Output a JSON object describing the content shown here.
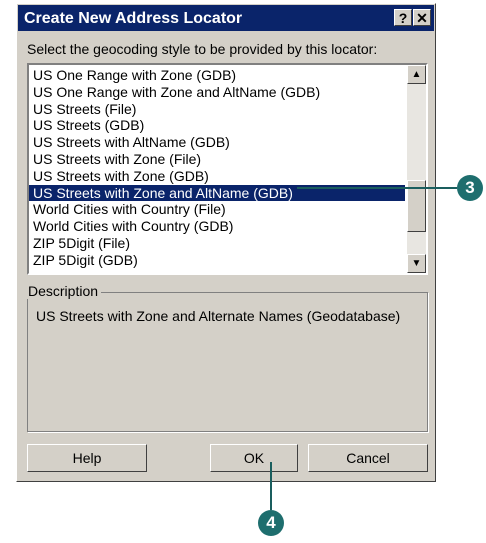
{
  "dialog": {
    "title": "Create New Address Locator",
    "help_glyph": "?",
    "close_glyph": "✕",
    "prompt": "Select the geocoding style to be provided by this locator:",
    "list_items": [
      "US One Range with Zone (GDB)",
      "US One Range with Zone and AltName (GDB)",
      "US Streets (File)",
      "US Streets (GDB)",
      "US Streets with AltName (GDB)",
      "US Streets with Zone (File)",
      "US Streets with Zone (GDB)",
      "US Streets with Zone and AltName (GDB)",
      "World Cities with Country (File)",
      "World Cities with Country (GDB)",
      "ZIP 5Digit (File)",
      "ZIP 5Digit (GDB)"
    ],
    "selected_index": 7,
    "scroll_up_glyph": "▲",
    "scroll_down_glyph": "▼",
    "description_label": "Description",
    "description_text": "US Streets with Zone and Alternate Names (Geodatabase)",
    "help_button": "Help",
    "ok_button": "OK",
    "cancel_button": "Cancel"
  },
  "callouts": {
    "step3": "3",
    "step4": "4"
  },
  "colors": {
    "titlebar": "#0a246a",
    "selection": "#0a246a",
    "dialog_face": "#d4d0c8",
    "callout": "#1e6e6e"
  }
}
